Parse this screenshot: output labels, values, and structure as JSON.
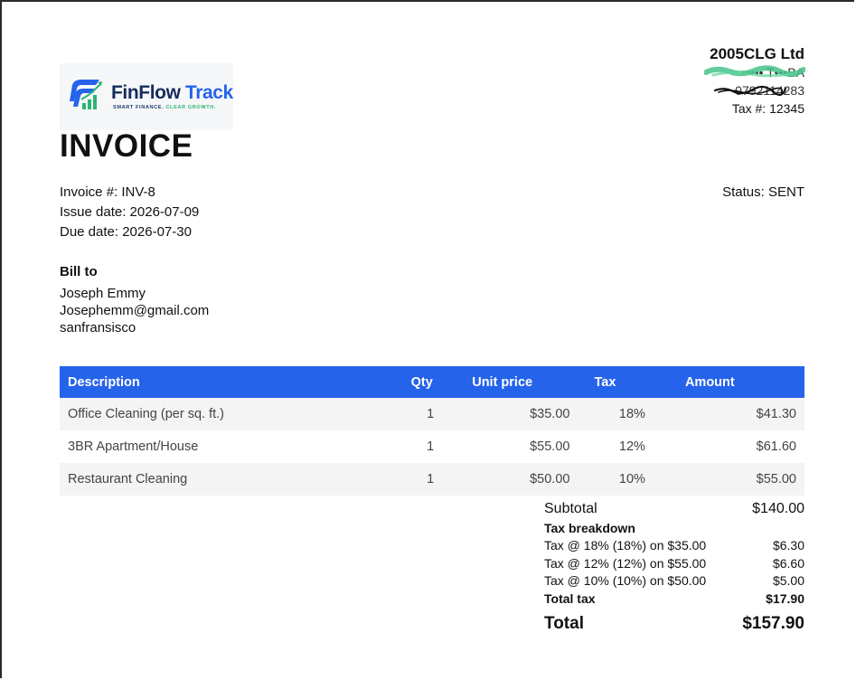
{
  "logo": {
    "brand_part1": "FinFlow",
    "brand_part2": "Track",
    "tagline_part1": "SMART FINANCE.",
    "tagline_part2": "CLEAR GROWTH.",
    "colors": {
      "navy": "#152c5b",
      "blue": "#2563eb",
      "green": "#2bb673"
    }
  },
  "company": {
    "name": "2005CLG Ltd",
    "address_redacted": "••••• T•••BA",
    "phone_redacted": "0792114283",
    "tax_number": "Tax #: 12345"
  },
  "document": {
    "title": "INVOICE",
    "invoice_number": "Invoice #: INV-8",
    "issue_date": "Issue date: 2026-07-09",
    "due_date": "Due date: 2026-07-30",
    "status": "Status: SENT"
  },
  "bill_to": {
    "heading": "Bill to",
    "name": "Joseph Emmy",
    "email": "Josephemm@gmail.com",
    "address": "sanfransisco"
  },
  "items_table": {
    "header_color": "#2563eb",
    "headers": {
      "description": "Description",
      "qty": "Qty",
      "unit_price": "Unit price",
      "tax": "Tax",
      "amount": "Amount"
    },
    "rows": [
      {
        "description": "Office Cleaning (per sq. ft.)",
        "qty": "1",
        "unit_price": "$35.00",
        "tax": "18%",
        "amount": "$41.30"
      },
      {
        "description": "3BR Apartment/House",
        "qty": "1",
        "unit_price": "$55.00",
        "tax": "12%",
        "amount": "$61.60"
      },
      {
        "description": "Restaurant Cleaning",
        "qty": "1",
        "unit_price": "$50.00",
        "tax": "10%",
        "amount": "$55.00"
      }
    ]
  },
  "totals": {
    "subtotal_label": "Subtotal",
    "subtotal_value": "$140.00",
    "tax_breakdown_heading": "Tax breakdown",
    "tax_lines": [
      {
        "label": "Tax @ 18% (18%) on $35.00",
        "value": "$6.30"
      },
      {
        "label": "Tax @ 12% (12%) on $55.00",
        "value": "$6.60"
      },
      {
        "label": "Tax @ 10% (10%) on $50.00",
        "value": "$5.00"
      }
    ],
    "total_tax_label": "Total tax",
    "total_tax_value": "$17.90",
    "total_label": "Total",
    "total_value": "$157.90"
  }
}
